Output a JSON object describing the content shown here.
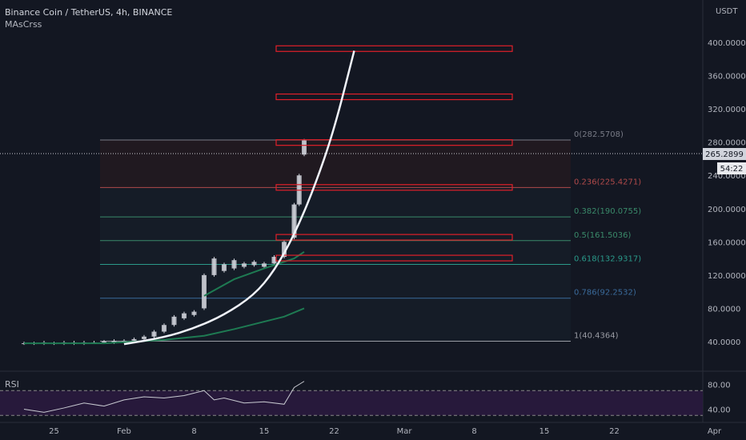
{
  "header": {
    "symbol": "Binance Coin / TetherUS, 4h, BINANCE",
    "indicator": "MAsCrss",
    "currency": "USDT",
    "rsi_label": "RSI"
  },
  "price_badge": {
    "price": "265.2899",
    "countdown": "54:22"
  },
  "colors": {
    "background": "#131722",
    "candle_up": "#d1d4dc",
    "curve": "#f0f3fa",
    "box": "#e0202a",
    "ma": "#1e7a52",
    "rsi_band": "#2a1a3e"
  },
  "chart_data": {
    "type": "candlestick",
    "title": "Binance Coin / TetherUS, 4h, BINANCE",
    "ylim": [
      10,
      430
    ],
    "y_ticks": [
      "400.0000",
      "360.0000",
      "320.0000",
      "280.0000",
      "240.0000",
      "200.0000",
      "160.0000",
      "120.0000",
      "80.0000",
      "40.0000"
    ],
    "y_tick_values": [
      400,
      360,
      320,
      280,
      240,
      200,
      160,
      120,
      80,
      40
    ],
    "x_ticks": [
      "25",
      "Feb",
      "8",
      "15",
      "22",
      "Mar",
      "8",
      "15",
      "22",
      "Apr"
    ],
    "x_tick_days": [
      -7,
      0,
      7,
      14,
      21,
      28,
      35,
      42,
      49,
      59
    ],
    "fib_levels": [
      {
        "label": "0(282.5708)",
        "value": 282.5708,
        "color": "#787b86"
      },
      {
        "label": "0.236(225.4271)",
        "value": 225.4271,
        "color": "#b04a4a"
      },
      {
        "label": "0.382(190.0755)",
        "value": 190.0755,
        "color": "#3a8a6a"
      },
      {
        "label": "0.5(161.5036)",
        "value": 161.5036,
        "color": "#3a8a6a"
      },
      {
        "label": "0.618(132.9317)",
        "value": 132.9317,
        "color": "#2a9a8a"
      },
      {
        "label": "0.786(92.2532)",
        "value": 92.2532,
        "color": "#3a6a9a"
      },
      {
        "label": "1(40.4364)",
        "value": 40.4364,
        "color": "#9a9ca4"
      }
    ],
    "boxes": [
      {
        "value": 393
      },
      {
        "value": 335
      },
      {
        "value": 280
      },
      {
        "value": 226
      },
      {
        "value": 166
      },
      {
        "value": 141
      }
    ],
    "candles": [
      [
        -10,
        38,
        38
      ],
      [
        -9,
        38,
        38
      ],
      [
        -8,
        38,
        39
      ],
      [
        -7,
        38,
        38
      ],
      [
        -6,
        38,
        39
      ],
      [
        -5,
        38,
        39
      ],
      [
        -4,
        38,
        39
      ],
      [
        -3,
        39,
        39
      ],
      [
        -2,
        39,
        40
      ],
      [
        -1,
        39,
        41
      ],
      [
        0,
        40,
        41
      ],
      [
        1,
        41,
        43
      ],
      [
        2,
        43,
        46
      ],
      [
        3,
        46,
        52
      ],
      [
        4,
        52,
        60
      ],
      [
        5,
        60,
        70
      ],
      [
        6,
        68,
        74
      ],
      [
        7,
        72,
        76
      ],
      [
        8,
        80,
        120
      ],
      [
        9,
        120,
        140
      ],
      [
        10,
        125,
        133
      ],
      [
        11,
        128,
        138
      ],
      [
        12,
        130,
        134
      ],
      [
        13,
        132,
        136
      ],
      [
        14,
        130,
        134
      ],
      [
        15,
        134,
        142
      ],
      [
        16,
        142,
        160
      ],
      [
        17,
        165,
        205
      ],
      [
        17.5,
        205,
        240
      ],
      [
        18,
        265,
        282
      ]
    ],
    "ma_points": [
      [
        -10,
        38
      ],
      [
        -2,
        38
      ],
      [
        4,
        42
      ],
      [
        8,
        47
      ],
      [
        11,
        55
      ],
      [
        14,
        64
      ],
      [
        16,
        70
      ],
      [
        18,
        80
      ]
    ],
    "ma_points_2": [
      [
        8,
        95
      ],
      [
        11,
        115
      ],
      [
        14,
        128
      ],
      [
        17,
        140
      ],
      [
        18,
        148
      ]
    ],
    "curve_points": [
      [
        0,
        37
      ],
      [
        4,
        45
      ],
      [
        7,
        56
      ],
      [
        10,
        72
      ],
      [
        13,
        96
      ],
      [
        15,
        125
      ],
      [
        17,
        168
      ],
      [
        19,
        225
      ],
      [
        21,
        295
      ],
      [
        23,
        390
      ]
    ],
    "rsi": {
      "y_ticks": [
        "80.00",
        "40.00"
      ],
      "y_tick_values": [
        80,
        40
      ],
      "ylim": [
        20,
        100
      ],
      "band": [
        30,
        70
      ],
      "values": [
        [
          -10,
          40
        ],
        [
          -8,
          35
        ],
        [
          -6,
          42
        ],
        [
          -4,
          50
        ],
        [
          -2,
          45
        ],
        [
          0,
          55
        ],
        [
          2,
          60
        ],
        [
          4,
          58
        ],
        [
          6,
          62
        ],
        [
          8,
          70
        ],
        [
          9,
          55
        ],
        [
          10,
          58
        ],
        [
          12,
          50
        ],
        [
          14,
          52
        ],
        [
          16,
          48
        ],
        [
          17,
          75
        ],
        [
          18,
          85
        ]
      ]
    }
  }
}
